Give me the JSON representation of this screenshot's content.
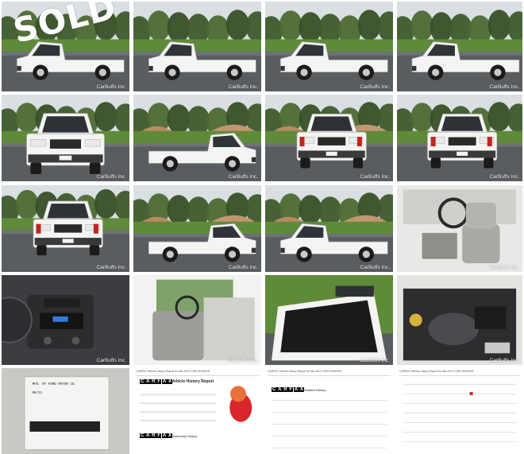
{
  "gallery": {
    "watermark": "CarBuffs Inc.",
    "badge": "SOLD",
    "label_sticker": {
      "line1": "MFD. BY FORD MOTOR CO.",
      "line2": "06/11"
    },
    "carfax_brand": [
      "C",
      "A",
      "R",
      "F",
      "A",
      "X"
    ],
    "carfax_doc1": {
      "header": "CARFAX Vehicle History Report for this 2011 FORD RANGER",
      "title": "Vehicle History Report",
      "subtitle": "Ownership History"
    },
    "carfax_doc2": {
      "header": "CARFAX Vehicle History Report for this 2011 FORD RANGER",
      "title": "Detailed History"
    },
    "carfax_doc3": {
      "header": "CARFAX Vehicle History Report for this 2011 FORD RANGER"
    }
  },
  "colors": {
    "truck_white": "#f4f4f2",
    "asphalt": "#5a5d60",
    "grass": "#5f8a3a",
    "sky": "#d9dfe2",
    "dirt": "#b88b63",
    "carfax_red": "#d9262a"
  }
}
